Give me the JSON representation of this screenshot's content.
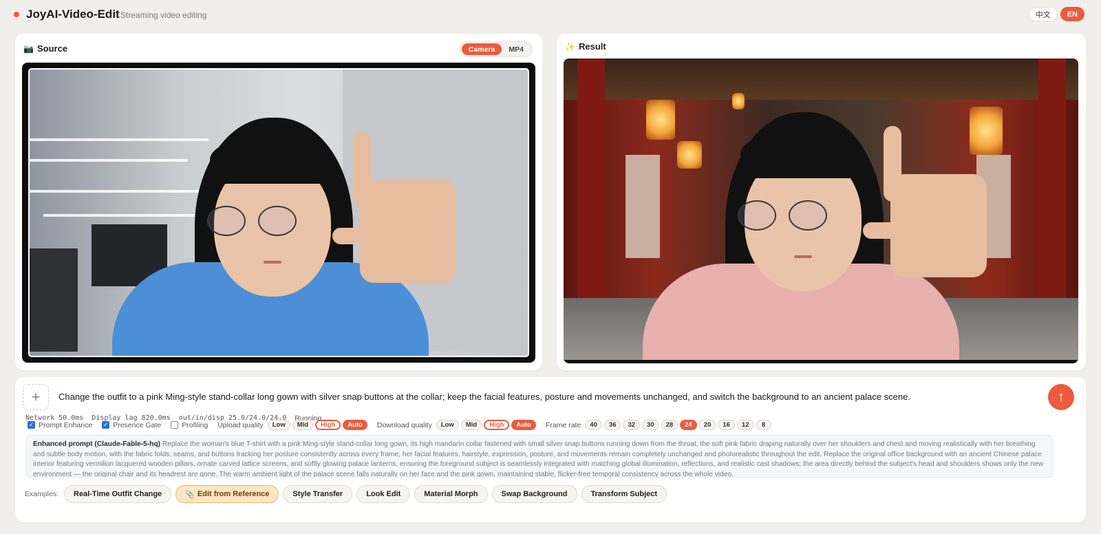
{
  "header": {
    "title": "JoyAI-Video-Edit",
    "subtitle": "Streaming video editing",
    "lang": [
      "中文",
      "EN"
    ]
  },
  "source": {
    "icon": "camera-icon",
    "title": "Source",
    "modes": [
      "Camera",
      "MP4"
    ]
  },
  "result": {
    "icon": "sparkle-icon",
    "title": "Result"
  },
  "prompt": {
    "text": "Change the outfit to a pink Ming-style stand-collar long gown with silver snap buttons at the collar; keep the facial features, posture and movements unchanged, and switch the background to an ancient palace scene."
  },
  "stats": {
    "network": "Network 50.0ms",
    "display_lag": "Display lag 820.0ms",
    "fps": "out/in/disp 25.0/24.0/24.0",
    "state": "Running"
  },
  "options": {
    "prompt_enhance": "Prompt Enhance",
    "presence_gate": "Presence Gate",
    "profiling": "Profiling",
    "upload_quality": "Upload quality",
    "download_quality": "Download quality",
    "quality_levels": [
      "Low",
      "Mid",
      "High",
      "Auto"
    ],
    "frame_rate": "Frame rate",
    "frame_rates": [
      "40",
      "36",
      "32",
      "30",
      "28",
      "24",
      "20",
      "16",
      "12",
      "8"
    ]
  },
  "enhanced": {
    "label": "Enhanced prompt (Claude-Fable-5-hq)",
    "text": "Replace the woman's blue T-shirt with a pink Ming-style stand-collar long gown, its high mandarin collar fastened with small silver snap buttons running down from the throat, the soft pink fabric draping naturally over her shoulders and chest and moving realistically with her breathing and subtle body motion, with the fabric folds, seams, and buttons tracking her posture consistently across every frame; her facial features, hairstyle, expression, posture, and movements remain completely unchanged and photorealistic throughout the edit. Replace the original office background with an ancient Chinese palace interior featuring vermilion lacquered wooden pillars, ornate carved lattice screens, and softly glowing palace lanterns, ensuring the foreground subject is seamlessly integrated with matching global illumination, reflections, and realistic cast shadows; the area directly behind the subject's head and shoulders shows only the new environment — the original chair and its headrest are gone. The warm ambient light of the palace scene falls naturally on her face and the pink gown, maintaining stable, flicker-free temporal consistency across the whole video."
  },
  "examples": {
    "label": "Examples:",
    "items": [
      "Real-Time Outfit Change",
      "Edit from Reference",
      "Style Transfer",
      "Look Edit",
      "Material Morph",
      "Swap Background",
      "Transform Subject"
    ]
  },
  "colors": {
    "accent": "#ec5b3d",
    "background": "#f1efeb",
    "highlight": "#fbe6c2"
  }
}
